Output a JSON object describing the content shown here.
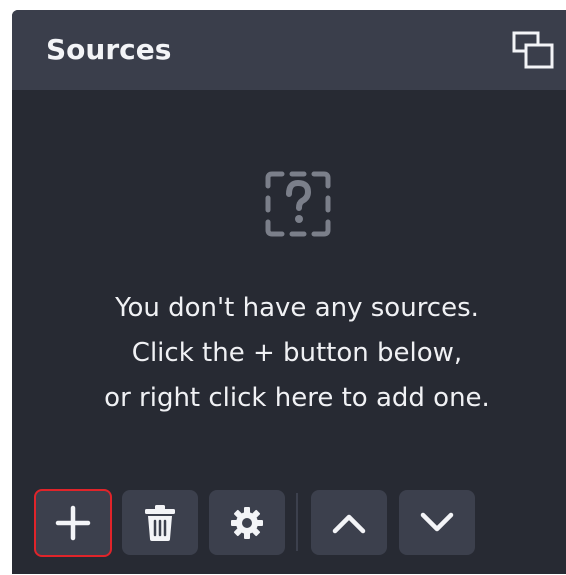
{
  "dock": {
    "title": "Sources",
    "undock_icon": "undock-windows-icon"
  },
  "empty_state": {
    "icon": "question-mark-placeholder-icon",
    "lines": [
      "You don't have any sources.",
      "Click the + button below,",
      "or right click here to add one."
    ]
  },
  "toolbar": {
    "buttons": [
      {
        "name": "add-source",
        "icon": "plus-icon",
        "highlighted": true
      },
      {
        "name": "remove-source",
        "icon": "trash-icon"
      },
      {
        "name": "source-properties",
        "icon": "gear-icon"
      },
      {
        "name": "move-source-up",
        "icon": "chevron-up-icon"
      },
      {
        "name": "move-source-down",
        "icon": "chevron-down-icon"
      }
    ]
  },
  "colors": {
    "panel_bg": "#272a33",
    "header_bg": "#3a3e4b",
    "button_bg": "#3c404d",
    "text": "#f0f1f4",
    "highlight": "#e0242a"
  }
}
